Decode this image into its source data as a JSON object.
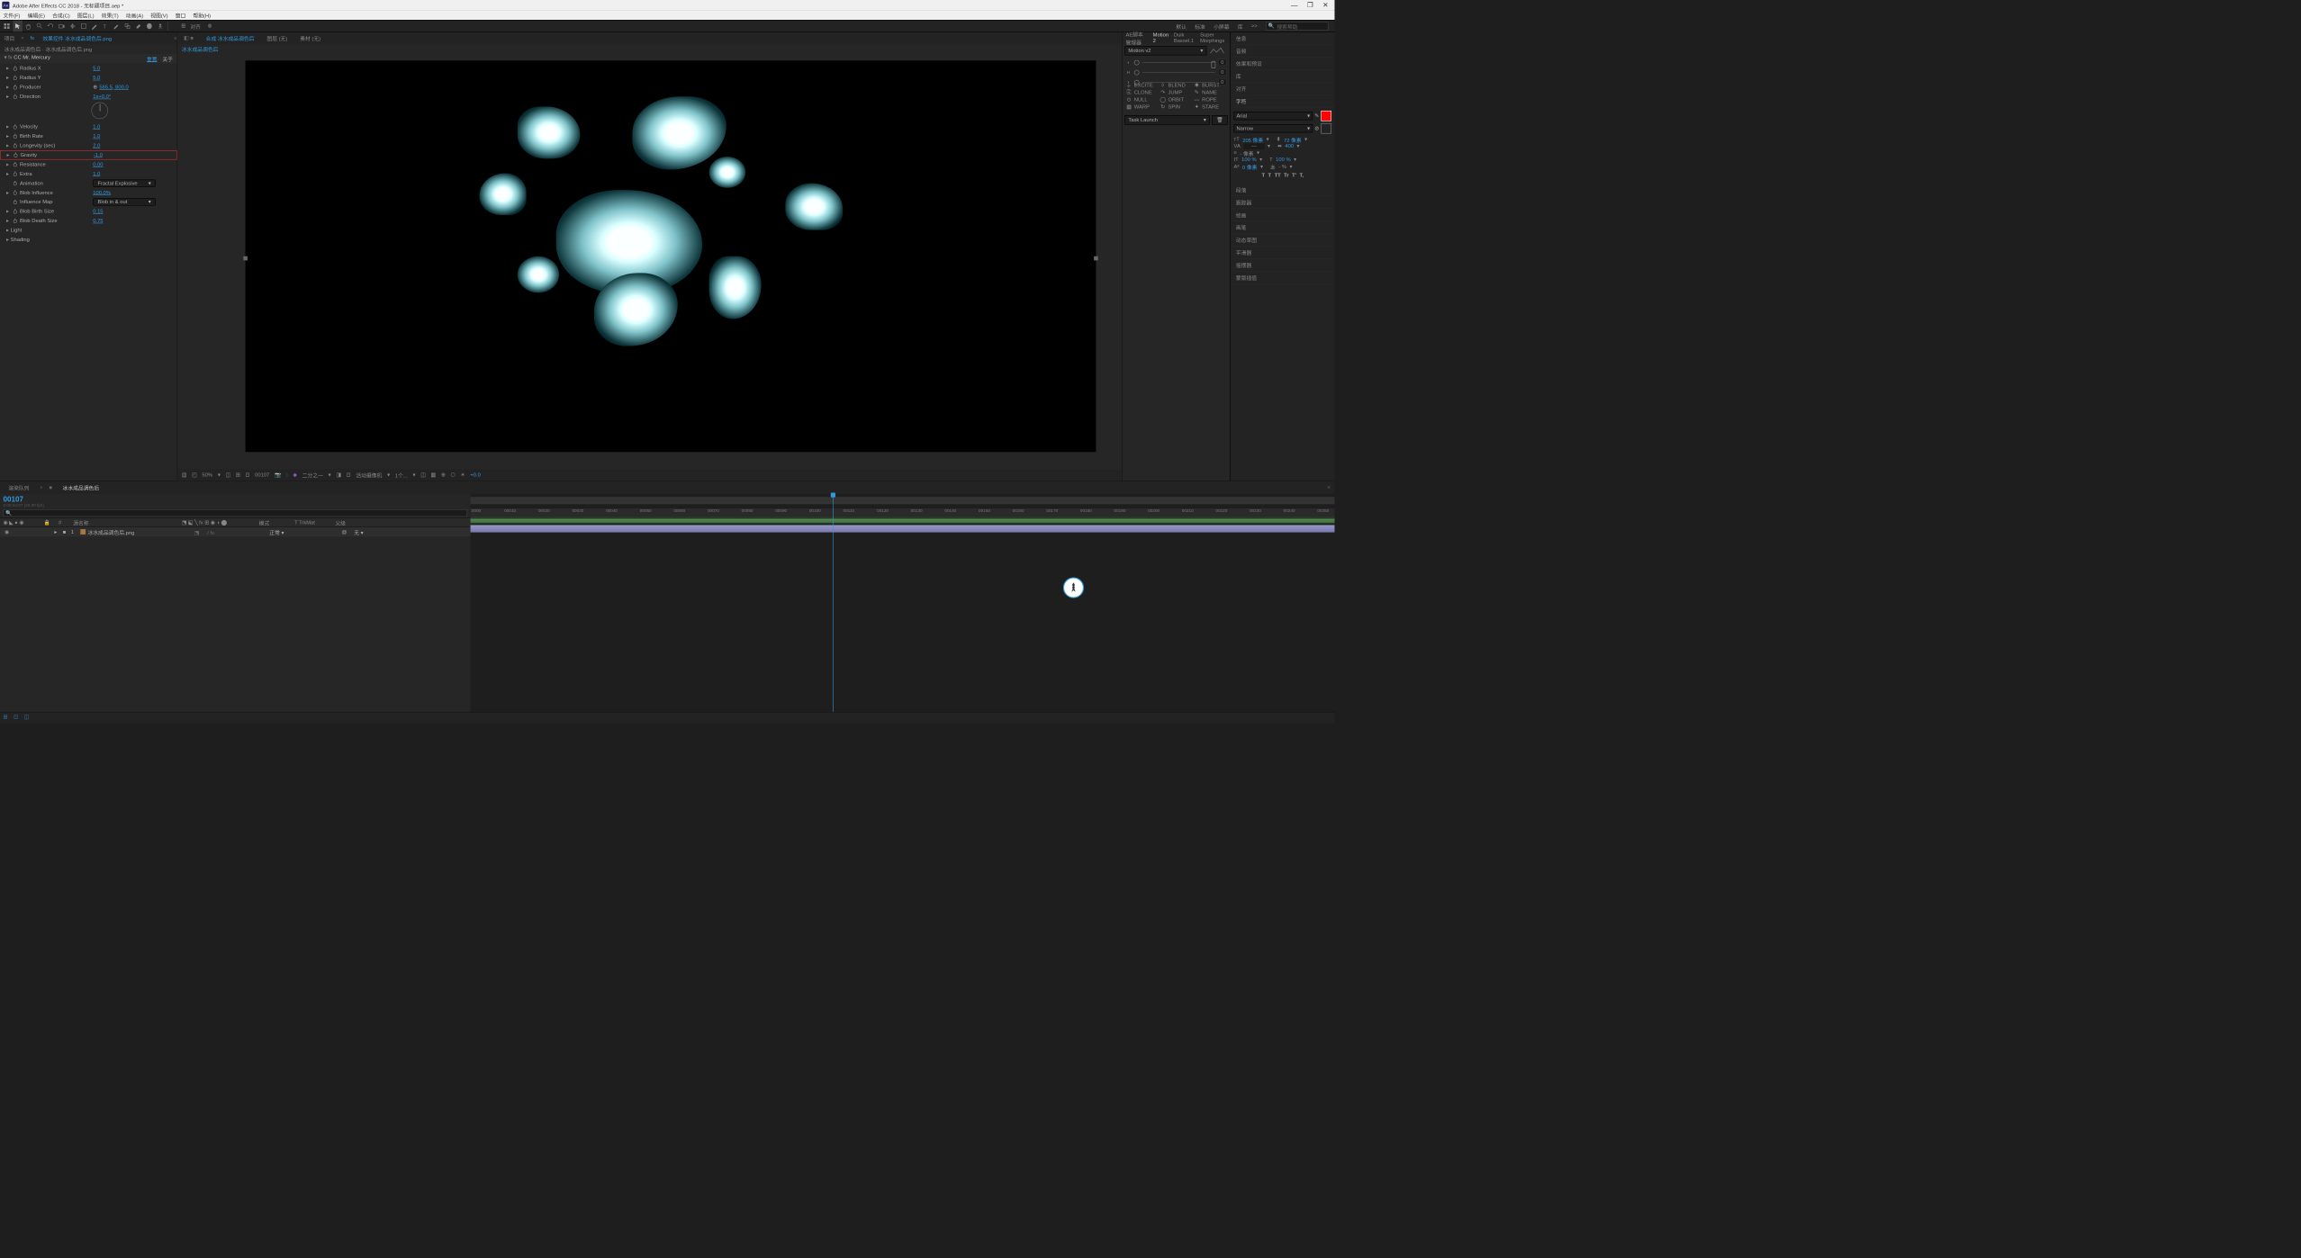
{
  "title": "Adobe After Effects CC 2018 - 无标题项目.aep *",
  "menu": [
    "文件(F)",
    "编辑(E)",
    "合成(C)",
    "图层(L)",
    "效果(T)",
    "动画(A)",
    "视图(V)",
    "窗口",
    "帮助(H)"
  ],
  "toolbar": {
    "snapping": "对齐",
    "mode": "▢",
    "exclude": "⊗"
  },
  "workspaces": [
    "默认",
    "标准",
    "小屏幕",
    "库",
    ">>"
  ],
  "search_placeholder": "搜索帮助",
  "effects_panel": {
    "tabs": [
      "项目",
      "效果控件 冰水成品调色后.png"
    ],
    "breadcrumb": "冰水成品调色后 · 冰水成品调色后.png",
    "effect_name": "CC Mr. Mercury",
    "reset": "重置",
    "about": "关于",
    "params": [
      {
        "name": "Radius X",
        "val": "5.0"
      },
      {
        "name": "Radius Y",
        "val": "5.0"
      },
      {
        "name": "Producer",
        "val": "565.5, 800.0",
        "crosshair": true
      },
      {
        "name": "Direction",
        "val": "1x+0.0°",
        "dial": true
      },
      {
        "name": "Velocity",
        "val": "1.0"
      },
      {
        "name": "Birth Rate",
        "val": "1.0"
      },
      {
        "name": "Longevity (sec)",
        "val": "2.0"
      },
      {
        "name": "Gravity",
        "val": "-1.0",
        "highlighted": true
      },
      {
        "name": "Resistance",
        "val": "0.00"
      },
      {
        "name": "Extra",
        "val": "1.0"
      },
      {
        "name": "Animation",
        "val": "Fractal Explosive",
        "dropdown": true,
        "no_tri": true
      },
      {
        "name": "Blob Influence",
        "val": "100.0%"
      },
      {
        "name": "Influence Map",
        "val": "Blob in & out",
        "dropdown": true,
        "no_tri": true
      },
      {
        "name": "Blob Birth Size",
        "val": "0.15"
      },
      {
        "name": "Blob Death Size",
        "val": "0.75"
      },
      {
        "name": "Light",
        "val": "",
        "group": true
      },
      {
        "name": "Shading",
        "val": "",
        "group": true
      }
    ]
  },
  "comp_panel": {
    "tabs": [
      "合成 冰水成品调色后",
      "图层 (无)",
      "素材 (无)"
    ],
    "subtab": "冰水成品调色后",
    "footer": {
      "zoom": "50%",
      "frame": "00107",
      "ratio": "二分之一",
      "camera": "活动摄像机",
      "views": "1个...",
      "exposure": "+0.0"
    }
  },
  "script_panel": {
    "tabs": [
      "AE脚本管理器",
      "Motion 2",
      "Duik Bassel.1",
      "Super Morphings"
    ],
    "preset": "Motion v2",
    "sliders": [
      {
        "icon": "‹",
        "val": "0"
      },
      {
        "icon": "›‹",
        "val": "0"
      },
      {
        "icon": "›",
        "val": "0"
      }
    ],
    "tools": [
      {
        "icon": "＋",
        "label": "EXCITE"
      },
      {
        "icon": "◊",
        "label": "BLEND"
      },
      {
        "icon": "✱",
        "label": "BURST"
      },
      {
        "icon": "⎘",
        "label": "CLONE"
      },
      {
        "icon": "↷",
        "label": "JUMP"
      },
      {
        "icon": "✎",
        "label": "NAME"
      },
      {
        "icon": "⊙",
        "label": "NULL"
      },
      {
        "icon": "◯",
        "label": "ORBIT"
      },
      {
        "icon": "〰",
        "label": "ROPE"
      },
      {
        "icon": "▦",
        "label": "WARP"
      },
      {
        "icon": "↻",
        "label": "SPIN"
      },
      {
        "icon": "✦",
        "label": "STARE"
      }
    ],
    "task": "Task Launch"
  },
  "right_sidebar": {
    "items": [
      "信息",
      "音频",
      "效果和预设",
      "库",
      "对齐",
      "字符",
      "段落",
      "跟踪器",
      "绘画",
      "画笔",
      "动态草图",
      "平滑器",
      "摇摆器",
      "蒙版插值"
    ],
    "active_idx": 5,
    "char": {
      "font": "Arial",
      "weight": "Narrow",
      "size": "205 像素",
      "leading": "72 像素",
      "kern_val": "",
      "track_val": "400",
      "scale1": "100 %",
      "scale2": "100 %",
      "baseline": "0 像素",
      "stroke": "- %",
      "format": [
        "T",
        "T",
        "TT",
        "Tr",
        "T'",
        "T,"
      ]
    }
  },
  "timeline": {
    "tabs": [
      "渲染队列",
      "冰水成品调色后"
    ],
    "timecode": "00107",
    "timecode_sub": "0:00:04:07 (25.00 fps)",
    "columns": {
      "source": "源名称",
      "mode": "模式",
      "trkmat": "T TrkMat",
      "parent": "父级"
    },
    "switches": "⬔⬕⬜⬛⬤◐◑◒",
    "layer": {
      "num": "1",
      "name": "冰水成品调色后.png",
      "mode": "正常",
      "trkmat": "",
      "parent": "无"
    },
    "ticks": [
      ":0000",
      "00010",
      "00020",
      "00030",
      "00040",
      "00050",
      "00060",
      "00070",
      "00080",
      "00090",
      "00100",
      "00110",
      "00120",
      "00130",
      "00140",
      "00150",
      "00160",
      "00170",
      "00180",
      "00190",
      "00200",
      "00210",
      "00220",
      "00230",
      "00240",
      "00250"
    ],
    "playhead_frame": 107,
    "total_frames": 250
  }
}
